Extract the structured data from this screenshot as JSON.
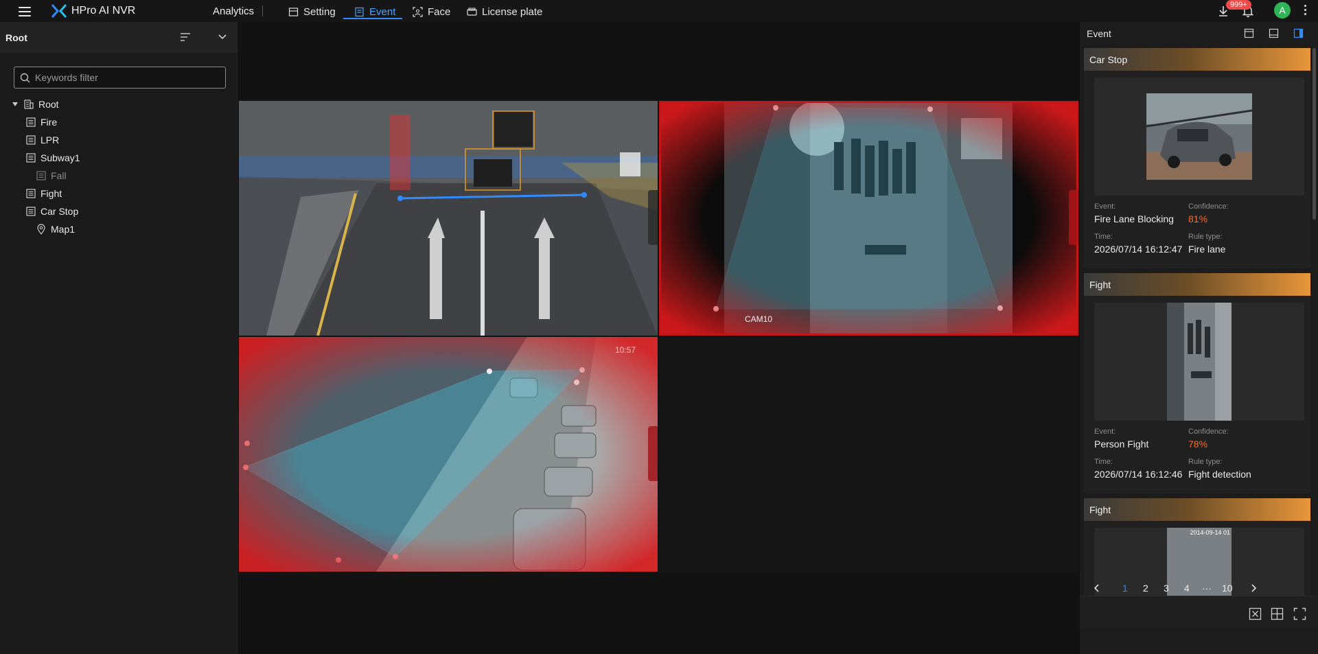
{
  "topbar": {
    "app_name": "HPro AI NVR",
    "analytics_label": "Analytics",
    "nav": [
      {
        "label": "Setting",
        "icon": "setting-icon"
      },
      {
        "label": "Event",
        "icon": "event-icon",
        "active": true
      },
      {
        "label": "Face",
        "icon": "face-icon"
      },
      {
        "label": "License plate",
        "icon": "license-plate-icon"
      }
    ],
    "notification_badge": "999+",
    "avatar_letter": "A"
  },
  "left_panel": {
    "title": "Root",
    "search_placeholder": "Keywords filter",
    "tree": {
      "root": "Root",
      "items": [
        {
          "label": "Fire",
          "enabled": true
        },
        {
          "label": "LPR",
          "enabled": true
        },
        {
          "label": "Subway1",
          "enabled": true
        },
        {
          "label": "Fall",
          "enabled": false
        },
        {
          "label": "Fight",
          "enabled": true
        },
        {
          "label": "Car Stop",
          "enabled": true
        }
      ],
      "map_item": "Map1"
    }
  },
  "video": {
    "tiles": [
      {
        "name": "traffic-crossing-camera",
        "overlay_text": ""
      },
      {
        "name": "alley-fight-camera",
        "overlay_text": "CAM10"
      },
      {
        "name": "riverside-parking-camera",
        "overlay_text": "10:57"
      }
    ]
  },
  "right_panel": {
    "title": "Event",
    "field_labels": {
      "event": "Event:",
      "confidence": "Confidence:",
      "time": "Time:",
      "rule_type": "Rule type:"
    },
    "events": [
      {
        "title": "Car Stop",
        "event": "Fire Lane Blocking",
        "confidence": "81%",
        "time": "2026/07/14 16:12:47",
        "rule_type": "Fire lane"
      },
      {
        "title": "Fight",
        "event": "Person Fight",
        "confidence": "78%",
        "time": "2026/07/14 16:12:46",
        "rule_type": "Fight detection"
      },
      {
        "title": "Fight",
        "thumb_stamp": "2014-09-14 01"
      }
    ],
    "pagination": {
      "pages": [
        "1",
        "2",
        "3",
        "4",
        "···",
        "10"
      ],
      "current": "1"
    }
  },
  "colors": {
    "accent": "#2f8bff",
    "confidence": "#ff6a2c",
    "alarm": "#d7191c",
    "card_title_gradient_end": "#e8963a"
  }
}
